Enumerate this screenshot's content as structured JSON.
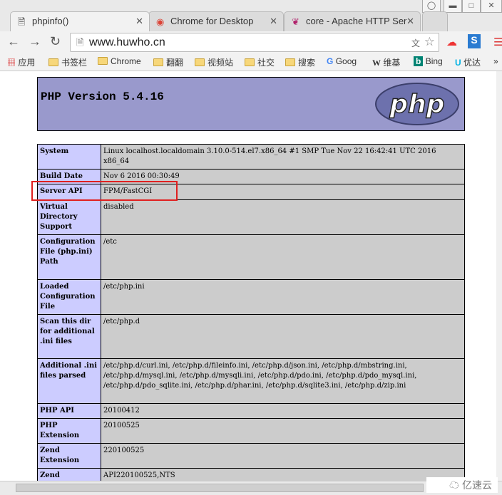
{
  "browser": {
    "tabs": [
      {
        "label": "phpinfo()",
        "icon": "page-icon",
        "active": true
      },
      {
        "label": "Chrome for Desktop",
        "icon": "chrome-icon"
      },
      {
        "label": "core - Apache HTTP Ser",
        "icon": "apache-feather-icon"
      }
    ],
    "url": "www.huwho.cn",
    "bookmarks": [
      {
        "label": "应用",
        "icon": "apps-grid-icon"
      },
      {
        "label": "书签栏",
        "icon": "folder-icon"
      },
      {
        "label": "Chrome",
        "icon": "folder-icon"
      },
      {
        "label": "翻翻",
        "icon": "folder-icon"
      },
      {
        "label": "视频站",
        "icon": "folder-icon"
      },
      {
        "label": "社交",
        "icon": "folder-icon"
      },
      {
        "label": "搜索",
        "icon": "folder-icon"
      },
      {
        "label": "Goog",
        "icon": "google-icon"
      },
      {
        "label": "维基",
        "icon": "wikipedia-icon"
      },
      {
        "label": "Bing",
        "icon": "bing-icon"
      },
      {
        "label": "优达",
        "icon": "udacity-icon"
      }
    ],
    "more": "»"
  },
  "php": {
    "version_title": "PHP Version 5.4.16",
    "logo_text": "php",
    "rows": [
      {
        "k": "System",
        "v": "Linux localhost.localdomain 3.10.0-514.el7.x86_64 #1 SMP Tue Nov 22 16:42:41 UTC 2016 x86_64"
      },
      {
        "k": "Build Date",
        "v": "Nov 6 2016 00:30:49"
      },
      {
        "k": "Server API",
        "v": "FPM/FastCGI"
      },
      {
        "k": "Virtual Directory Support",
        "v": "disabled"
      },
      {
        "k": "Configuration File (php.ini) Path",
        "v": "/etc"
      },
      {
        "k": "Loaded Configuration File",
        "v": "/etc/php.ini"
      },
      {
        "k": "Scan this dir for additional .ini files",
        "v": "/etc/php.d"
      },
      {
        "k": "Additional .ini files parsed",
        "v": "/etc/php.d/curl.ini, /etc/php.d/fileinfo.ini, /etc/php.d/json.ini, /etc/php.d/mbstring.ini, /etc/php.d/mysql.ini, /etc/php.d/mysqli.ini, /etc/php.d/pdo.ini, /etc/php.d/pdo_mysql.ini, /etc/php.d/pdo_sqlite.ini, /etc/php.d/phar.ini, /etc/php.d/sqlite3.ini, /etc/php.d/zip.ini"
      },
      {
        "k": "PHP API",
        "v": "20100412"
      },
      {
        "k": "PHP Extension",
        "v": "20100525"
      },
      {
        "k": "Zend Extension",
        "v": "220100525"
      },
      {
        "k": "Zend Extension",
        "v": "API220100525,NTS"
      }
    ]
  },
  "watermark": "亿速云",
  "colors": {
    "header_bg": "#9999cc",
    "key_bg": "#ccccff",
    "value_bg": "#cccccc",
    "highlight": "#e02020"
  }
}
